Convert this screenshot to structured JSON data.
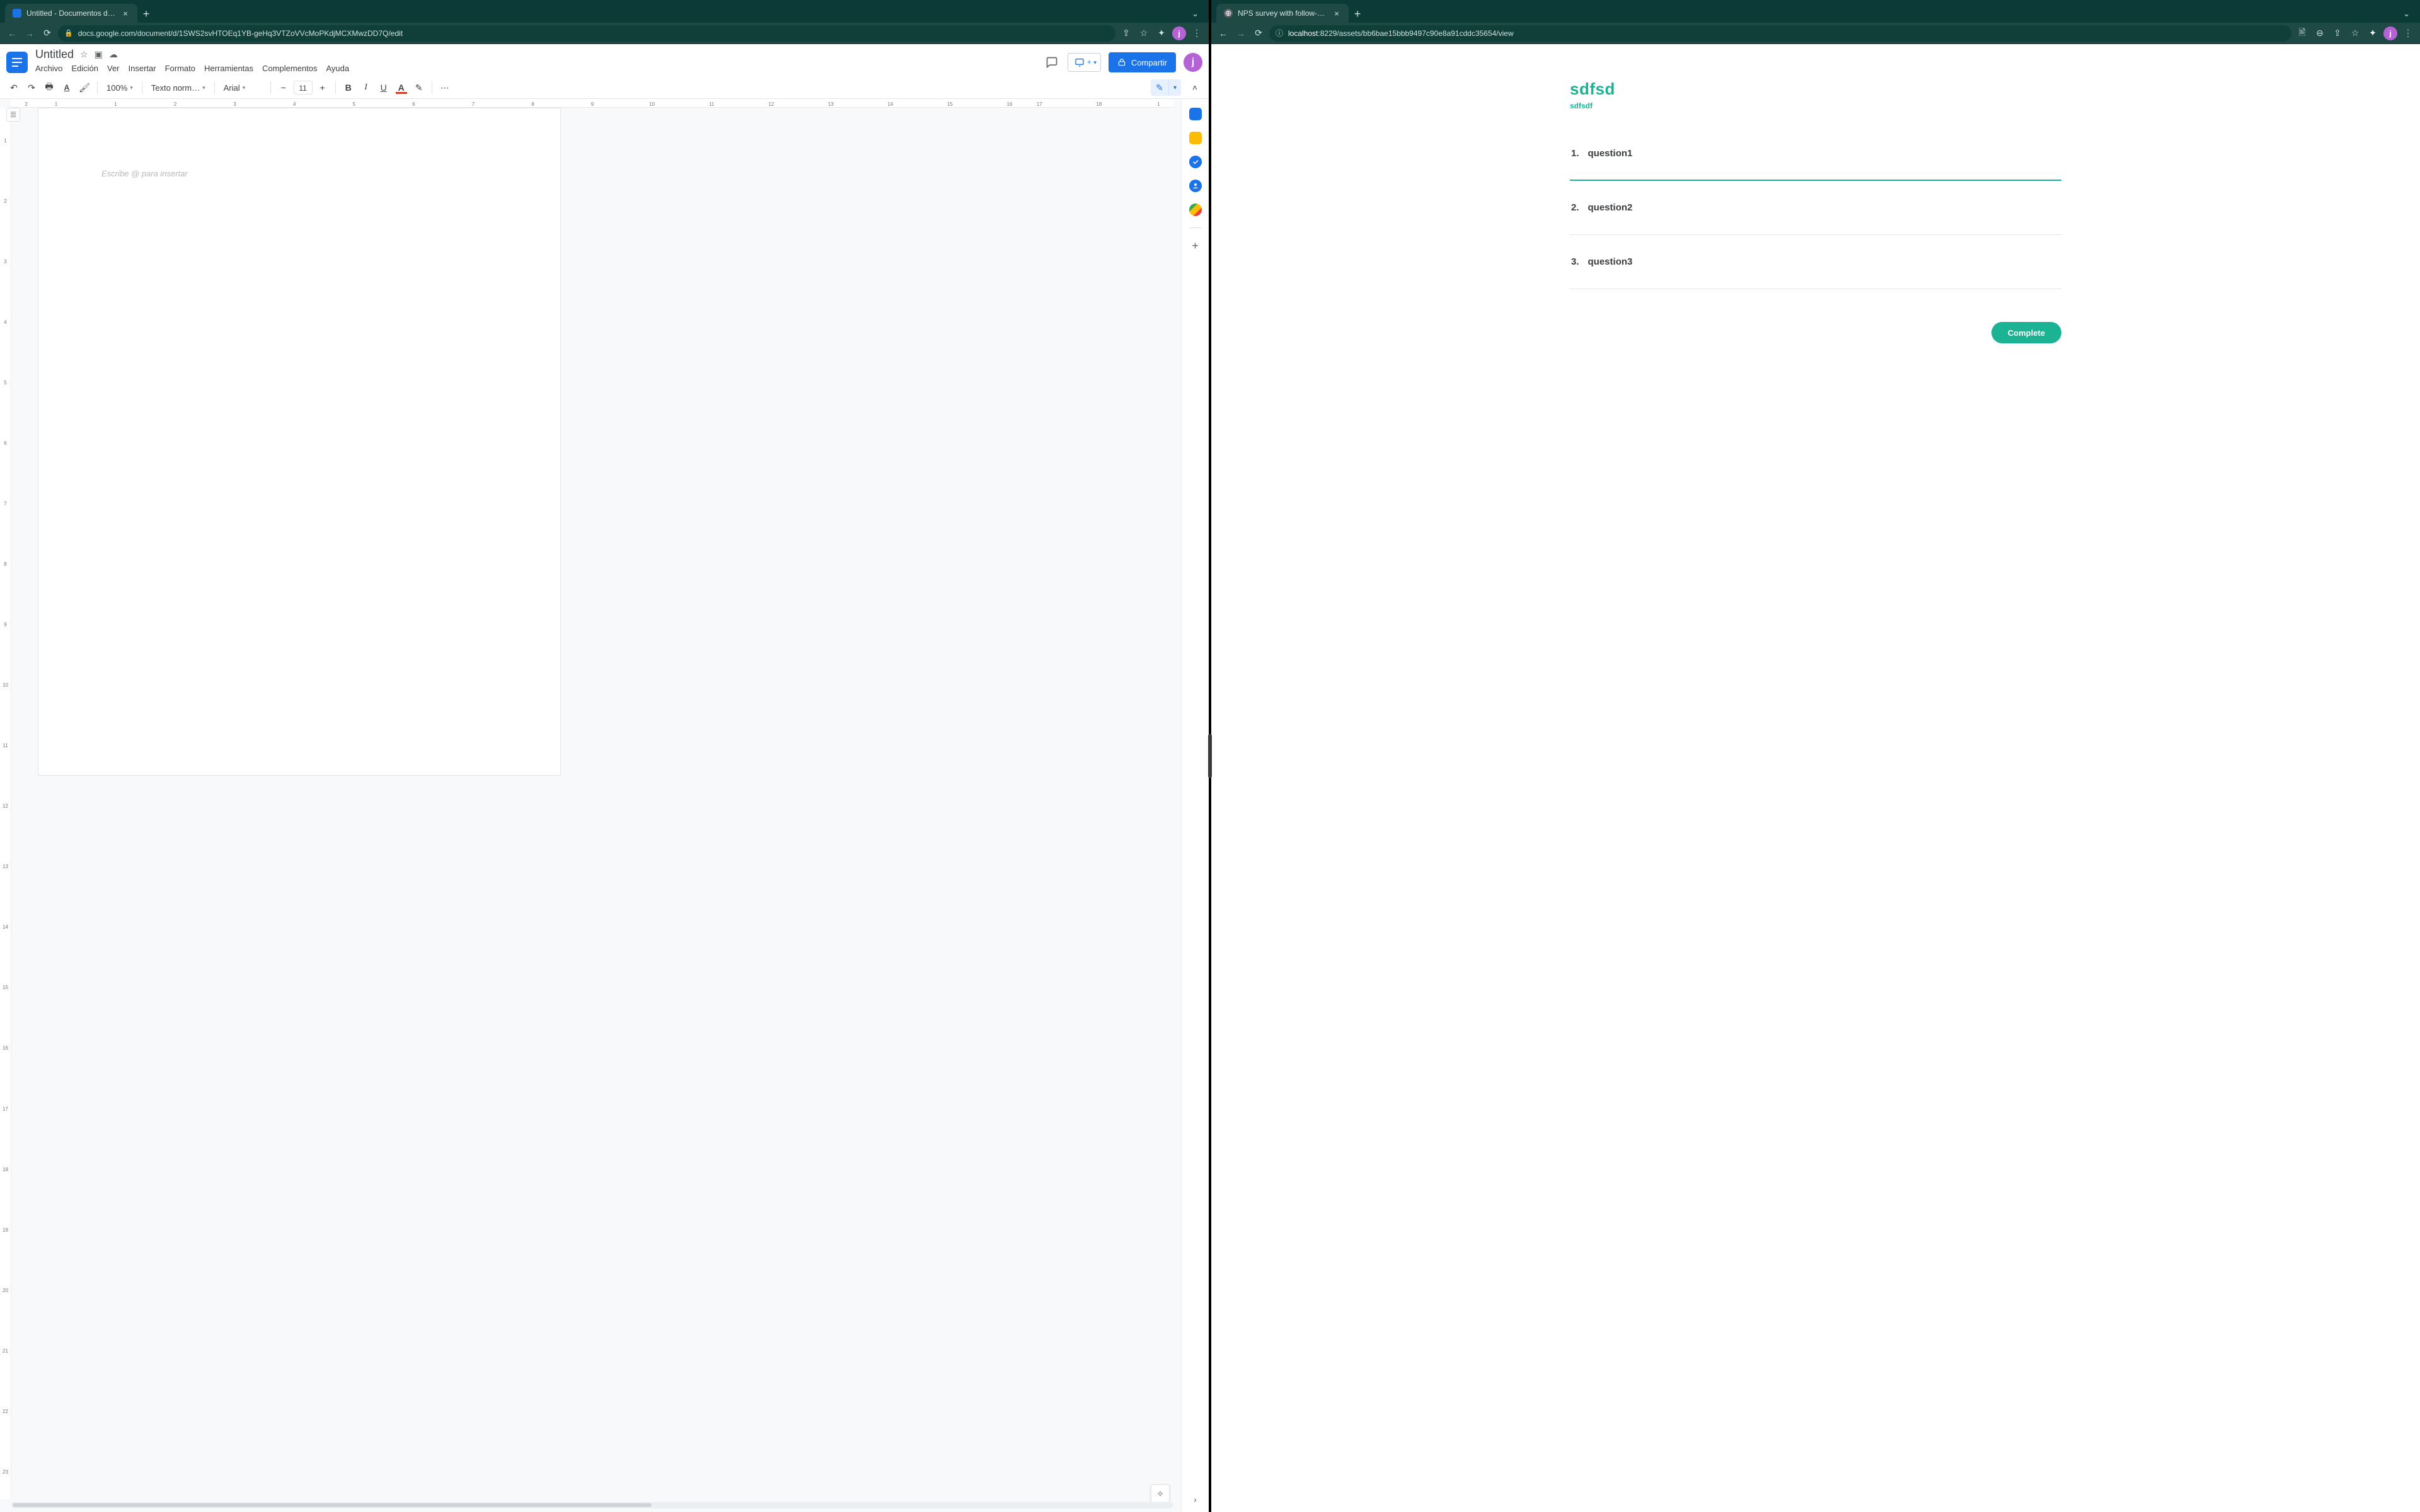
{
  "left": {
    "tab_title": "Untitled - Documentos de Goo",
    "url": "docs.google.com/document/d/1SWS2svHTOEq1YB-geHq3VTZoVVcMoPKdjMCXMwzDD7Q/edit",
    "avatar_letter": "j",
    "doc_title": "Untitled",
    "share_label": "Compartir",
    "menus": [
      "Archivo",
      "Edición",
      "Ver",
      "Insertar",
      "Formato",
      "Herramientas",
      "Complementos",
      "Ayuda"
    ],
    "zoom": "100%",
    "style": "Texto norm…",
    "font": "Arial",
    "font_size": "11",
    "placeholder": "Escribe @ para insertar",
    "ruler_top": [
      "2",
      "1",
      "",
      "1",
      "",
      "2",
      "",
      "3",
      "",
      "4",
      "",
      "5",
      "",
      "6",
      "",
      "7",
      "",
      "8",
      "",
      "9",
      "",
      "10",
      "",
      "11",
      "",
      "12",
      "",
      "13",
      "",
      "14",
      "",
      "15",
      "",
      "16",
      "17",
      "",
      "18",
      "",
      "1"
    ],
    "ruler_left": [
      "",
      "1",
      "",
      "2",
      "",
      "3",
      "",
      "4",
      "",
      "5",
      "",
      "6",
      "",
      "7",
      "",
      "8",
      "",
      "9",
      "",
      "10",
      "",
      "11",
      "",
      "12",
      "",
      "13",
      "",
      "14",
      "",
      "15",
      "",
      "16",
      "",
      "17",
      "",
      "18",
      "",
      "19",
      "",
      "20",
      "",
      "21",
      "",
      "22",
      "",
      "23"
    ]
  },
  "right": {
    "tab_title": "NPS survey with follow-up que",
    "url_host": "localhost",
    "url_rest": ":8229/assets/bb6bae15bbb9497c90e8a91cddc35654/view",
    "avatar_letter": "j",
    "survey_title": "sdfsd",
    "survey_sub": "sdfsdf",
    "questions": [
      "question1",
      "question2",
      "question3"
    ],
    "complete_label": "Complete"
  }
}
